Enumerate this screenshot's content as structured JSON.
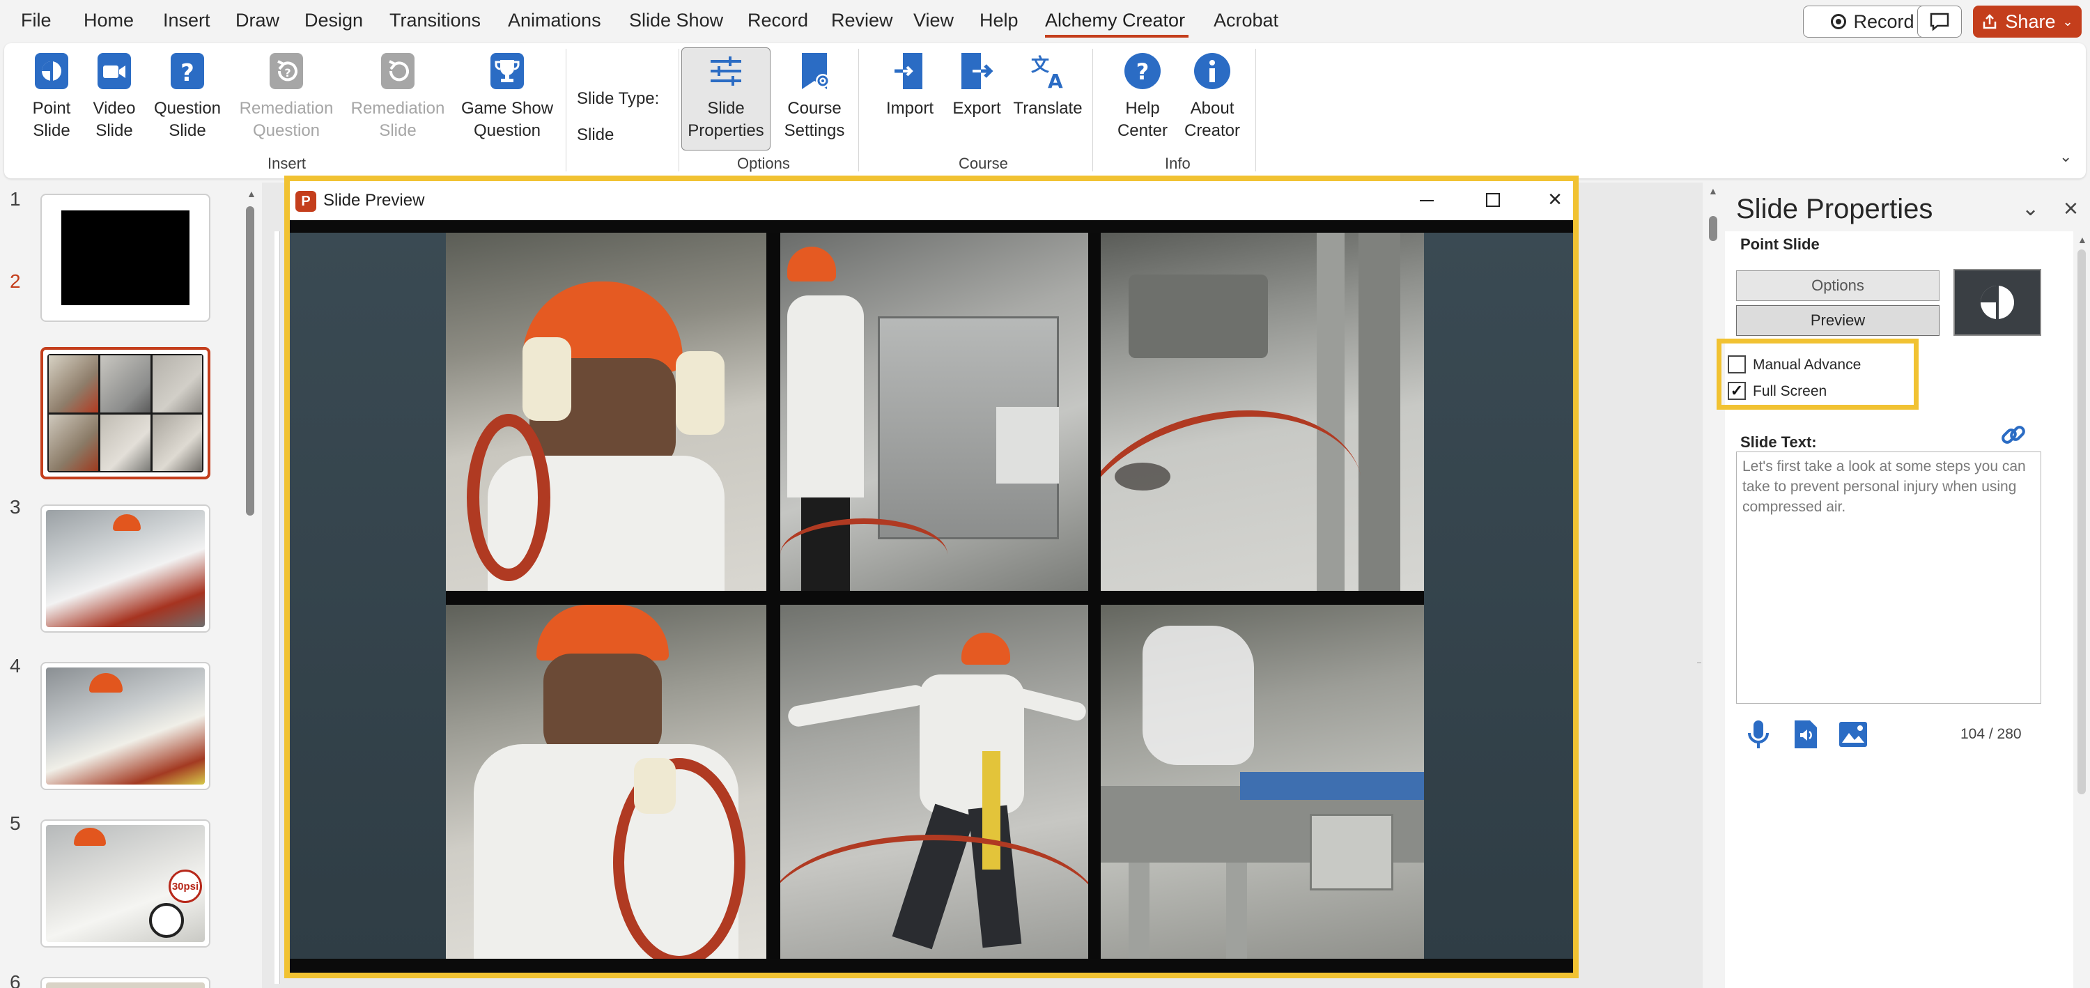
{
  "menu": {
    "tabs": [
      "File",
      "Home",
      "Insert",
      "Draw",
      "Design",
      "Transitions",
      "Animations",
      "Slide Show",
      "Record",
      "Review",
      "View",
      "Help",
      "Alchemy Creator",
      "Acrobat"
    ],
    "active_tab": "Alchemy Creator",
    "record_label": "Record",
    "share_label": "Share"
  },
  "ribbon": {
    "insert": {
      "point_slide": "Point\nSlide",
      "video_slide": "Video\nSlide",
      "question_slide": "Question\nSlide",
      "remediation_question": "Remediation\nQuestion",
      "remediation_slide": "Remediation\nSlide",
      "game_show_question": "Game Show\nQuestion",
      "group_label": "Insert"
    },
    "slide_type_label": "Slide Type:",
    "slide_type_value": "Slide",
    "options": {
      "slide_properties": "Slide\nProperties",
      "course_settings": "Course\nSettings",
      "group_label": "Options"
    },
    "course": {
      "import": "Import",
      "export": "Export",
      "translate": "Translate",
      "group_label": "Course"
    },
    "info": {
      "help_center": "Help\nCenter",
      "about_creator": "About\nCreator",
      "group_label": "Info"
    }
  },
  "thumbnails": {
    "numbers": [
      "1",
      "2",
      "3",
      "4",
      "5",
      "6"
    ],
    "active": "2",
    "badge_30psi": "30psi"
  },
  "preview_window": {
    "title": "Slide Preview"
  },
  "slide_properties": {
    "title": "Slide Properties",
    "slide_kind": "Point Slide",
    "options_label": "Options",
    "preview_label": "Preview",
    "manual_advance_label": "Manual Advance",
    "manual_advance_checked": false,
    "full_screen_label": "Full Screen",
    "full_screen_checked": true,
    "slide_text_label": "Slide Text:",
    "slide_text": "Let's first take a look at some steps you can take to prevent personal injury when using compressed air.",
    "char_count": "104 / 280"
  },
  "colors": {
    "accent": "#c43e1c",
    "highlight": "#f1c232",
    "icon_blue": "#2b6cc4"
  }
}
